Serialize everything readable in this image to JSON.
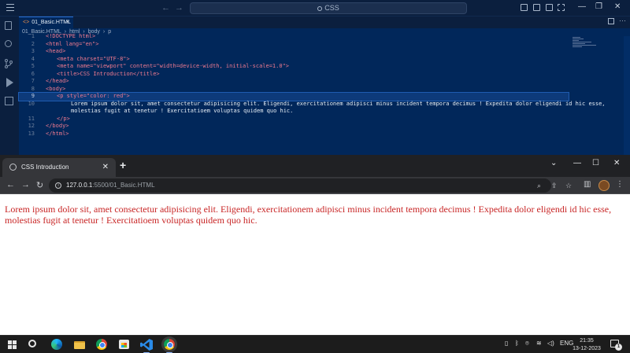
{
  "vscode": {
    "command_center": "CSS",
    "tab": {
      "label": "01_Basic.HTML"
    },
    "breadcrumbs": [
      "01_Basic.HTML",
      "html",
      "body",
      "p"
    ],
    "lines": [
      {
        "n": "1",
        "text": "<!DOCTYPE html>"
      },
      {
        "n": "2",
        "text": "<html lang=\"en\">"
      },
      {
        "n": "3",
        "text": "<head>"
      },
      {
        "n": "4",
        "text": "<meta charset=\"UTF-8\">"
      },
      {
        "n": "5",
        "text": "<meta name=\"viewport\" content=\"width=device-width, initial-scale=1.0\">"
      },
      {
        "n": "6",
        "text": "<title>CSS Introduction</title>"
      },
      {
        "n": "7",
        "text": "</head>"
      },
      {
        "n": "8",
        "text": "<body>"
      },
      {
        "n": "9",
        "text": "<p style=\"color: red\">"
      },
      {
        "n": "10",
        "text": "Lorem ipsum dolor sit, amet consectetur adipisicing elit. Eligendi, exercitationem adipisci minus incident tempora decimus ! Expedita dolor eligendi id hic esse,"
      },
      {
        "n": "",
        "text": "molestias fugit at tenetur ! Exercitatioem voluptas quidem quo hic."
      },
      {
        "n": "11",
        "text": "</p>"
      },
      {
        "n": "12",
        "text": "</body>"
      },
      {
        "n": "13",
        "text": "</html>"
      }
    ]
  },
  "chrome": {
    "tab_title": "CSS Introduction",
    "url_host": "127.0.0.1",
    "url_path": ":5500/01_Basic.HTML",
    "paragraph": "Lorem ipsum dolor sit, amet consectetur adipisicing elit. Eligendi, exercitationem adipisci minus incident tempora decimus ! Expedita dolor eligendi id hic esse, molestias fugit at tenetur ! Exercitatioem voluptas quidem quo hic.",
    "paragraph_color": "#c82525"
  },
  "taskbar": {
    "language": "ENG",
    "time": "21:35",
    "date": "13-12-2023",
    "notification_count": "1"
  }
}
